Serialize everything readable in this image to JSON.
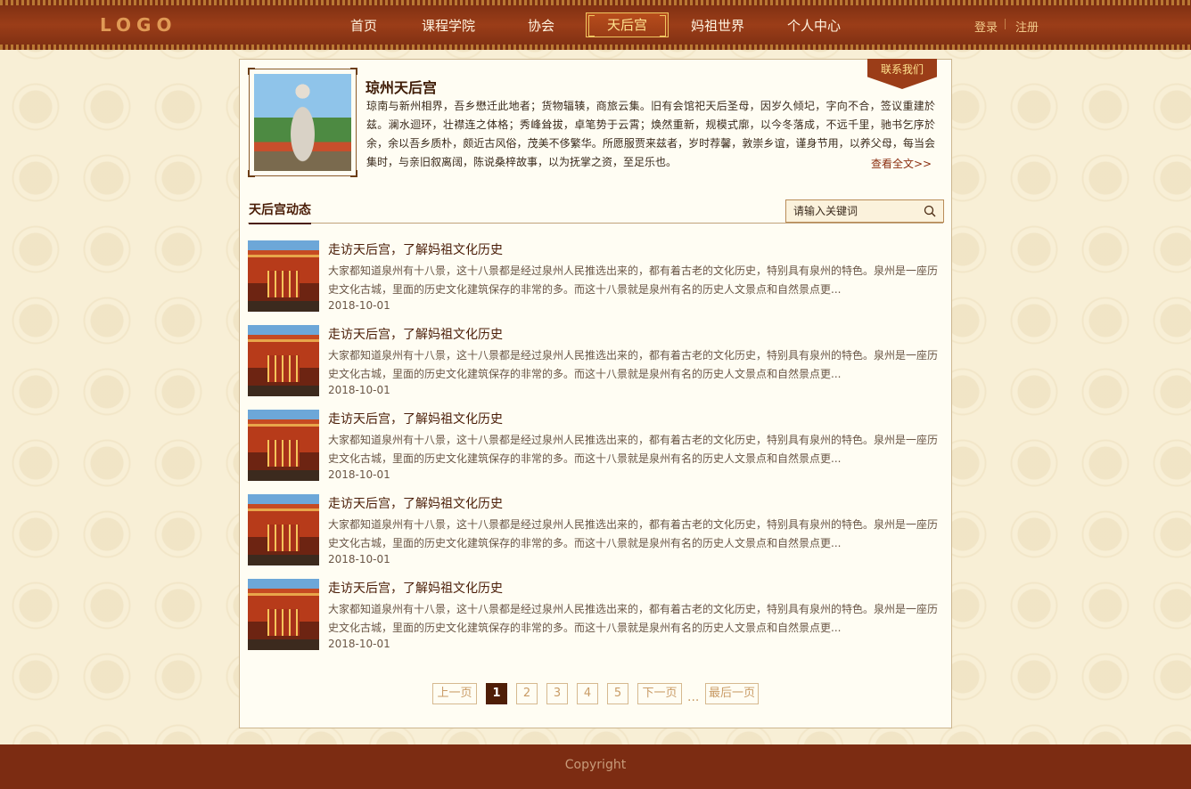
{
  "header": {
    "logo": "LOGO",
    "nav": [
      {
        "label": "首页"
      },
      {
        "label": "课程学院"
      },
      {
        "label": "协会"
      },
      {
        "label": "天后宫"
      },
      {
        "label": "妈祖世界"
      },
      {
        "label": "个人中心"
      }
    ],
    "active_nav": "天后宫",
    "login": "登录",
    "register": "注册"
  },
  "intro": {
    "title": "琼州天后宫",
    "description": "琼南与新州相界，吾乡懋迁此地者；货物辐辏，商旅云集。旧有会馆祀天后圣母，因岁久倾圮，字向不合，签议重建於兹。澜水迴环，壮襟连之体格；秀峰耸拔，卓笔势于云霄；焕然重新，规模式廓，以今冬落成，不远千里，驰书乞序於余，余以吾乡质朴，颇近古风俗，茂美不侈繁华。所愿服贾来兹者，岁时荐馨，敦崇乡谊，谨身节用，以养父母，每当会集时，与亲旧叙离阔，陈说桑梓故事，以为抚掌之资，至足乐也。",
    "read_more": "查看全文>>",
    "contact": "联系我们"
  },
  "news_section": {
    "title": "天后宫动态",
    "search_placeholder": "请输入关键词",
    "items": [
      {
        "title": "走访天后宫，了解妈祖文化历史",
        "excerpt": "大家都知道泉州有十八景，这十八景都是经过泉州人民推选出来的，都有着古老的文化历史，特别具有泉州的特色。泉州是一座历史文化古城，里面的历史文化建筑保存的非常的多。而这十八景就是泉州有名的历史人文景点和自然景点更...",
        "date": "2018-10-01"
      },
      {
        "title": "走访天后宫，了解妈祖文化历史",
        "excerpt": "大家都知道泉州有十八景，这十八景都是经过泉州人民推选出来的，都有着古老的文化历史，特别具有泉州的特色。泉州是一座历史文化古城，里面的历史文化建筑保存的非常的多。而这十八景就是泉州有名的历史人文景点和自然景点更...",
        "date": "2018-10-01"
      },
      {
        "title": "走访天后宫，了解妈祖文化历史",
        "excerpt": "大家都知道泉州有十八景，这十八景都是经过泉州人民推选出来的，都有着古老的文化历史，特别具有泉州的特色。泉州是一座历史文化古城，里面的历史文化建筑保存的非常的多。而这十八景就是泉州有名的历史人文景点和自然景点更...",
        "date": "2018-10-01"
      },
      {
        "title": "走访天后宫，了解妈祖文化历史",
        "excerpt": "大家都知道泉州有十八景，这十八景都是经过泉州人民推选出来的，都有着古老的文化历史，特别具有泉州的特色。泉州是一座历史文化古城，里面的历史文化建筑保存的非常的多。而这十八景就是泉州有名的历史人文景点和自然景点更...",
        "date": "2018-10-01"
      },
      {
        "title": "走访天后宫，了解妈祖文化历史",
        "excerpt": "大家都知道泉州有十八景，这十八景都是经过泉州人民推选出来的，都有着古老的文化历史，特别具有泉州的特色。泉州是一座历史文化古城，里面的历史文化建筑保存的非常的多。而这十八景就是泉州有名的历史人文景点和自然景点更...",
        "date": "2018-10-01"
      }
    ]
  },
  "pagination": {
    "prev": "上一页",
    "pages": [
      "1",
      "2",
      "3",
      "4",
      "5"
    ],
    "current": "1",
    "next": "下一页",
    "ellipsis": "...",
    "last": "最后一页"
  },
  "footer": {
    "copyright": "Copyright"
  },
  "colors": {
    "header_bg": "#7a2e12",
    "accent_gold": "#f0c660",
    "brand_dark": "#4a1d07",
    "page_bg": "#f8efd6"
  }
}
